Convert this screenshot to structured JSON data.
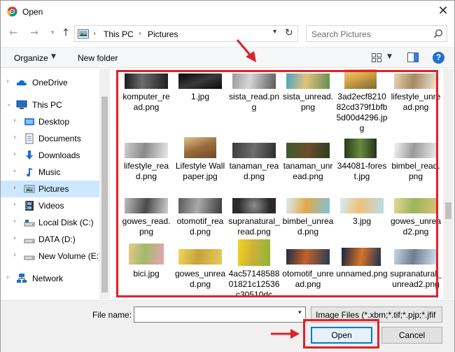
{
  "window": {
    "title": "Open"
  },
  "address": {
    "crumbs": [
      "This PC",
      "Pictures"
    ]
  },
  "search": {
    "placeholder": "Search Pictures"
  },
  "toolbar": {
    "organize": "Organize",
    "new_folder": "New folder"
  },
  "sidebar": {
    "items": [
      {
        "label": "OneDrive",
        "icon": "cloud-icon"
      },
      {
        "label": "This PC",
        "icon": "computer-icon"
      },
      {
        "label": "Desktop",
        "icon": "desktop-folder-icon"
      },
      {
        "label": "Documents",
        "icon": "documents-icon"
      },
      {
        "label": "Downloads",
        "icon": "download-arrow-icon"
      },
      {
        "label": "Music",
        "icon": "music-note-icon"
      },
      {
        "label": "Pictures",
        "icon": "pictures-folder-icon",
        "selected": true
      },
      {
        "label": "Videos",
        "icon": "film-icon"
      },
      {
        "label": "Local Disk (C:)",
        "icon": "disk-drive-icon"
      },
      {
        "label": "DATA (D:)",
        "icon": "disk-drive-icon"
      },
      {
        "label": "New Volume (E:)",
        "icon": "disk-drive-icon"
      },
      {
        "label": "Network",
        "icon": "network-icon"
      }
    ]
  },
  "files": [
    {
      "name": "komputer_read.png"
    },
    {
      "name": "1.jpg"
    },
    {
      "name": "sista_read.png"
    },
    {
      "name": "sista_unread.png"
    },
    {
      "name": "3ad2ecf821082cd379f1bfb5d00d4296.jpg"
    },
    {
      "name": "lifestyle_unread.png"
    },
    {
      "name": "lifestyle_read.png"
    },
    {
      "name": "Lifestyle Wallpaper.jpg"
    },
    {
      "name": "tanaman_read.png"
    },
    {
      "name": "tanaman_unread.png"
    },
    {
      "name": "344081-forest.jpg"
    },
    {
      "name": "bimbel_read.png"
    },
    {
      "name": "gowes_read.png"
    },
    {
      "name": "otomotif_read.png"
    },
    {
      "name": "supranatural_read.png"
    },
    {
      "name": "bimbel_unread.png"
    },
    {
      "name": "3.jpg"
    },
    {
      "name": "gowes_unread2.png"
    },
    {
      "name": "bici.jpg"
    },
    {
      "name": "gowes_unread.png"
    },
    {
      "name": "4ac5714858801821c12536c30510dc"
    },
    {
      "name": "otomotif_unread.png"
    },
    {
      "name": "unnamed.png"
    },
    {
      "name": "supranatural_unread2.png"
    }
  ],
  "bottom": {
    "file_name_label": "File name:",
    "file_name_value": "",
    "file_type": "Image Files (*.xbm;*.tif;*.pjp;*.jfif",
    "open_label": "Open",
    "cancel_label": "Cancel"
  }
}
